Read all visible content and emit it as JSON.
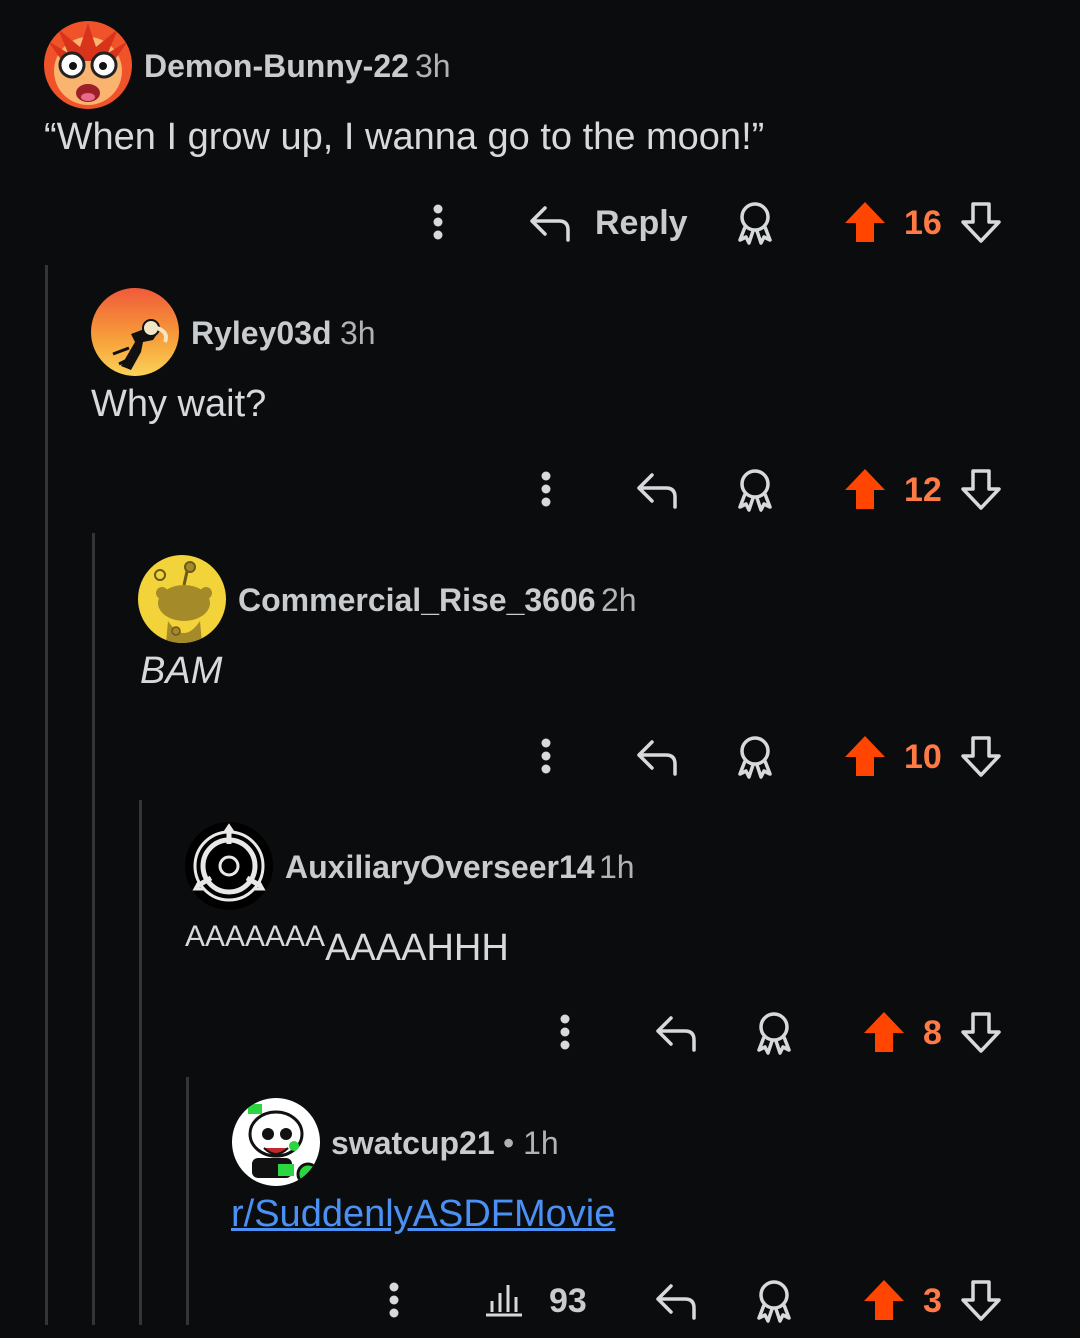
{
  "comments": [
    {
      "author": "Demon-Bunny-22",
      "time": "3h",
      "text": "“When I grow up, I wanna go to the moon!”",
      "reply_label": "Reply",
      "score": "16"
    },
    {
      "author": "Ryley03d",
      "time": "3h",
      "text": "Why wait?",
      "score": "12"
    },
    {
      "author": "Commercial_Rise_3606",
      "time": "2h",
      "text": "BAM",
      "score": "10"
    },
    {
      "author": "AuxiliaryOverseer14",
      "time": "1h",
      "text_small": "AAAAAAA",
      "text_large": "AAAAHHH",
      "score": "8"
    },
    {
      "author": "swatcup21",
      "time": "• 1h",
      "link_text": "r/SuddenlyASDFMovie",
      "views": "93",
      "score": "3"
    }
  ],
  "colors": {
    "upvote": "#ff4500",
    "score": "#ff7a45",
    "link": "#4a90f5",
    "background": "#0b0c0d",
    "thread_line": "#343536"
  },
  "icons": [
    "more-icon",
    "reply-icon",
    "award-icon",
    "upvote-icon",
    "downvote-icon",
    "stats-icon"
  ]
}
